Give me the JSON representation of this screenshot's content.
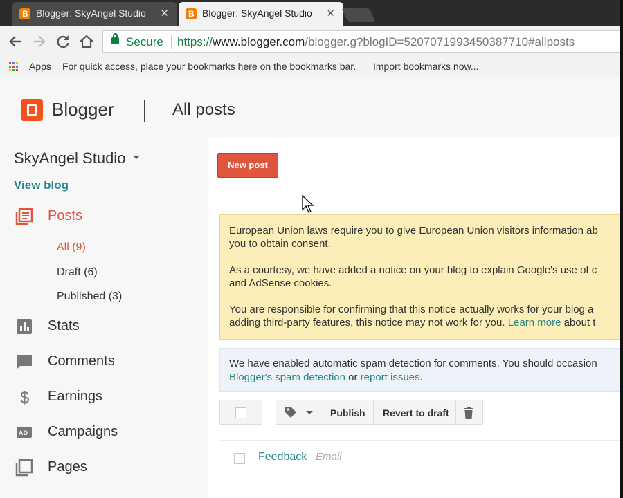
{
  "browser": {
    "tabs": [
      {
        "title": "Blogger: SkyAngel Studio",
        "active": false
      },
      {
        "title": "Blogger: SkyAngel Studio",
        "active": true
      }
    ],
    "close_glyph": "✕",
    "secure_label": "Secure",
    "url": {
      "scheme": "https://",
      "host": "www.blogger.com",
      "path": "/blogger.g?blogID=5207071993450387710#allposts"
    },
    "bookmarks": {
      "apps_label": "Apps",
      "hint": "For quick access, place your bookmarks here on the bookmarks bar.",
      "import_link": "Import bookmarks now..."
    }
  },
  "header": {
    "brand": "Blogger",
    "page_title": "All posts"
  },
  "sidebar": {
    "blog_name": "SkyAngel Studio",
    "view_blog": "View blog",
    "posts": {
      "label": "Posts",
      "subitems": [
        {
          "label": "All (9)",
          "active": true
        },
        {
          "label": "Draft (6)",
          "active": false
        },
        {
          "label": "Published (3)",
          "active": false
        }
      ]
    },
    "items": [
      {
        "label": "Stats",
        "icon": "stats-icon"
      },
      {
        "label": "Comments",
        "icon": "comments-icon"
      },
      {
        "label": "Earnings",
        "icon": "dollar-icon"
      },
      {
        "label": "Campaigns",
        "icon": "ad-icon"
      },
      {
        "label": "Pages",
        "icon": "pages-icon"
      }
    ]
  },
  "main": {
    "new_post": "New post",
    "eu_notice": {
      "p1_line1": "European Union laws require you to give European Union visitors information ab",
      "p1_line2": "you to obtain consent.",
      "p2_line1": "As a courtesy, we have added a notice on your blog to explain Google's use of c",
      "p2_line2": "and AdSense cookies.",
      "p3_line1": "You are responsible for confirming that this notice actually works for your blog a",
      "p3_line2_pre": "adding third-party features, this notice may not work for you. ",
      "p3_link": "Learn more",
      "p3_line2_post": " about t"
    },
    "spam_notice": {
      "line1": "We have enabled automatic spam detection for comments. You should occasion",
      "link1": "Blogger's spam detection",
      "mid": " or ",
      "link2": "report issues",
      "end": "."
    },
    "actions": {
      "publish": "Publish",
      "revert": "Revert to draft"
    },
    "posts": [
      {
        "title": "Feedback",
        "label": "Email"
      }
    ]
  },
  "colors": {
    "accent": "#e0553d",
    "link": "#26878b",
    "notice_yellow": "#fbeeb8",
    "notice_blue": "#eef2f9",
    "secure_green": "#0b8043"
  }
}
